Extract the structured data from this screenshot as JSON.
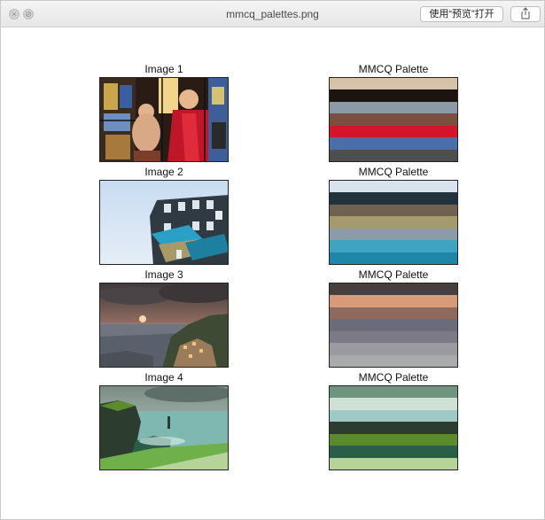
{
  "window": {
    "title": "mmcq_palettes.png",
    "open_with_label": "使用“预览”打开",
    "share_icon": "share-icon"
  },
  "rows": [
    {
      "image_title": "Image 1",
      "palette_title": "MMCQ Palette",
      "image_subject": "stained glass window",
      "palette": [
        "#d6c2a8",
        "#1d1410",
        "#8c9aa8",
        "#7a4f3f",
        "#d4142a",
        "#4a6fa8",
        "#4d4e50"
      ]
    },
    {
      "image_title": "Image 2",
      "palette_title": "MMCQ Palette",
      "image_subject": "building with graffiti under blue sky",
      "palette": [
        "#d8e3ee",
        "#23333d",
        "#6f6250",
        "#a59a6e",
        "#8a9ca8",
        "#3fa3c2",
        "#1e86a8"
      ]
    },
    {
      "image_title": "Image 3",
      "palette_title": "MMCQ Palette",
      "image_subject": "coastal village at sunset",
      "palette": [
        "#463f3d",
        "#d89a78",
        "#8e6a5e",
        "#6a6c7c",
        "#7c7a86",
        "#9a9aa0",
        "#a8aaac"
      ]
    },
    {
      "image_title": "Image 4",
      "palette_title": "MMCQ Palette",
      "image_subject": "green sea cliffs",
      "palette": [
        "#6f9580",
        "#cfe0d6",
        "#9ec9c6",
        "#2c3d30",
        "#5c8a2e",
        "#2b5e48",
        "#b6d49a"
      ]
    }
  ]
}
